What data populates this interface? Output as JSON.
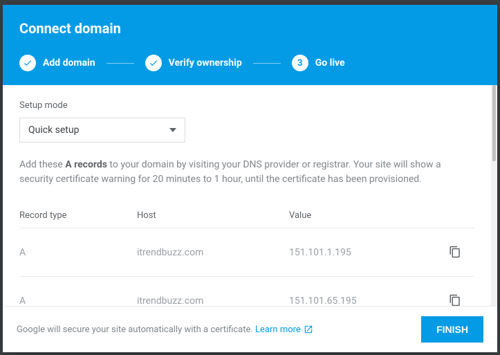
{
  "title": "Connect domain",
  "steps": [
    {
      "label": "Add domain",
      "done": true
    },
    {
      "label": "Verify ownership",
      "done": true
    },
    {
      "label": "Go live",
      "number": "3",
      "active": true
    }
  ],
  "setup_mode": {
    "label": "Setup mode",
    "value": "Quick setup"
  },
  "instructions": {
    "pre": "Add these ",
    "bold": "A records",
    "post": " to your domain by visiting your DNS provider or registrar. Your site will show a security certificate warning for 20 minutes to 1 hour, until the certificate has been provisioned."
  },
  "table": {
    "headers": {
      "type": "Record type",
      "host": "Host",
      "value": "Value"
    },
    "rows": [
      {
        "type": "A",
        "host": "itrendbuzz.com",
        "value": "151.101.1.195"
      },
      {
        "type": "A",
        "host": "itrendbuzz.com",
        "value": "151.101.65.195"
      }
    ]
  },
  "footer": {
    "text": "Google will secure your site automatically with a certificate. ",
    "learn": "Learn more",
    "finish": "Finish"
  }
}
